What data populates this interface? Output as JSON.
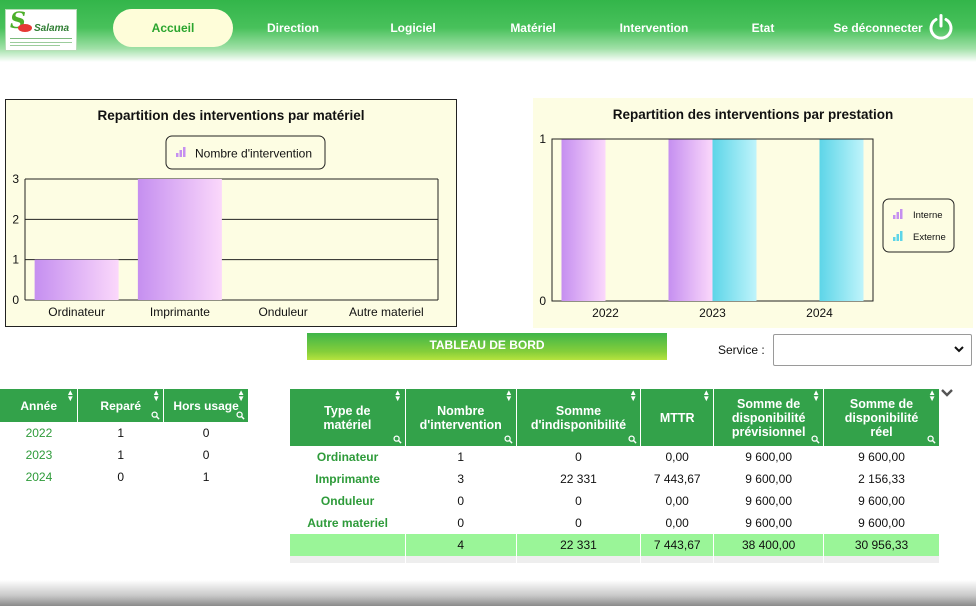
{
  "brand": {
    "name": "Salama"
  },
  "nav": {
    "items": [
      {
        "label": "Accueil"
      },
      {
        "label": "Direction"
      },
      {
        "label": "Logiciel"
      },
      {
        "label": "Matériel"
      },
      {
        "label": "Intervention"
      },
      {
        "label": "Etat"
      },
      {
        "label": "Se déconnecter"
      }
    ],
    "active": "Accueil",
    "icons": [
      "power-icon"
    ]
  },
  "colors": {
    "nav_green": "#33b54a",
    "panel_bg": "#fdfde3",
    "purple_bar": "#c58ff0",
    "cyan_bar": "#5dd5e8",
    "header_green": "#33a24a",
    "total_row": "#9af598"
  },
  "chart_data": [
    {
      "type": "bar",
      "title": "Repartition des interventions par matériel",
      "categories": [
        "Ordinateur",
        "Imprimante",
        "Onduleur",
        "Autre materiel"
      ],
      "series": [
        {
          "name": "Nombre d'intervention",
          "values": [
            1,
            3,
            0,
            0
          ]
        }
      ],
      "ylim": [
        0,
        3
      ],
      "yticks": [
        0,
        1,
        2,
        3
      ],
      "grid": true,
      "legend": "top"
    },
    {
      "type": "bar",
      "title": "Repartition des interventions par prestation",
      "categories": [
        "2022",
        "2023",
        "2024"
      ],
      "series": [
        {
          "name": "Interne",
          "values": [
            1,
            1,
            0
          ]
        },
        {
          "name": "Externe",
          "values": [
            0,
            1,
            1
          ]
        }
      ],
      "ylim": [
        0,
        1
      ],
      "yticks": [
        0,
        1
      ],
      "grid": false,
      "legend": "right"
    }
  ],
  "dashboard": {
    "title": "TABLEAU DE BORD",
    "service_label": "Service :",
    "service_value": ""
  },
  "table_years": {
    "headers": [
      "Année",
      "Reparé",
      "Hors usage"
    ],
    "rows": [
      [
        "2022",
        "1",
        "0"
      ],
      [
        "2023",
        "1",
        "0"
      ],
      [
        "2024",
        "0",
        "1"
      ]
    ]
  },
  "table_types": {
    "headers": [
      "Type de matériel",
      "Nombre d'intervention",
      "Somme d'indisponibilité",
      "MTTR",
      "Somme de disponibilité prévisionnel",
      "Somme de disponibilité réel"
    ],
    "rows": [
      [
        "Ordinateur",
        "1",
        "0",
        "0,00",
        "9 600,00",
        "9 600,00"
      ],
      [
        "Imprimante",
        "3",
        "22 331",
        "7 443,67",
        "9 600,00",
        "2 156,33"
      ],
      [
        "Onduleur",
        "0",
        "0",
        "0,00",
        "9 600,00",
        "9 600,00"
      ],
      [
        "Autre materiel",
        "0",
        "0",
        "0,00",
        "9 600,00",
        "9 600,00"
      ]
    ],
    "totals": [
      "",
      "4",
      "22 331",
      "7 443,67",
      "38 400,00",
      "30 956,33"
    ]
  }
}
